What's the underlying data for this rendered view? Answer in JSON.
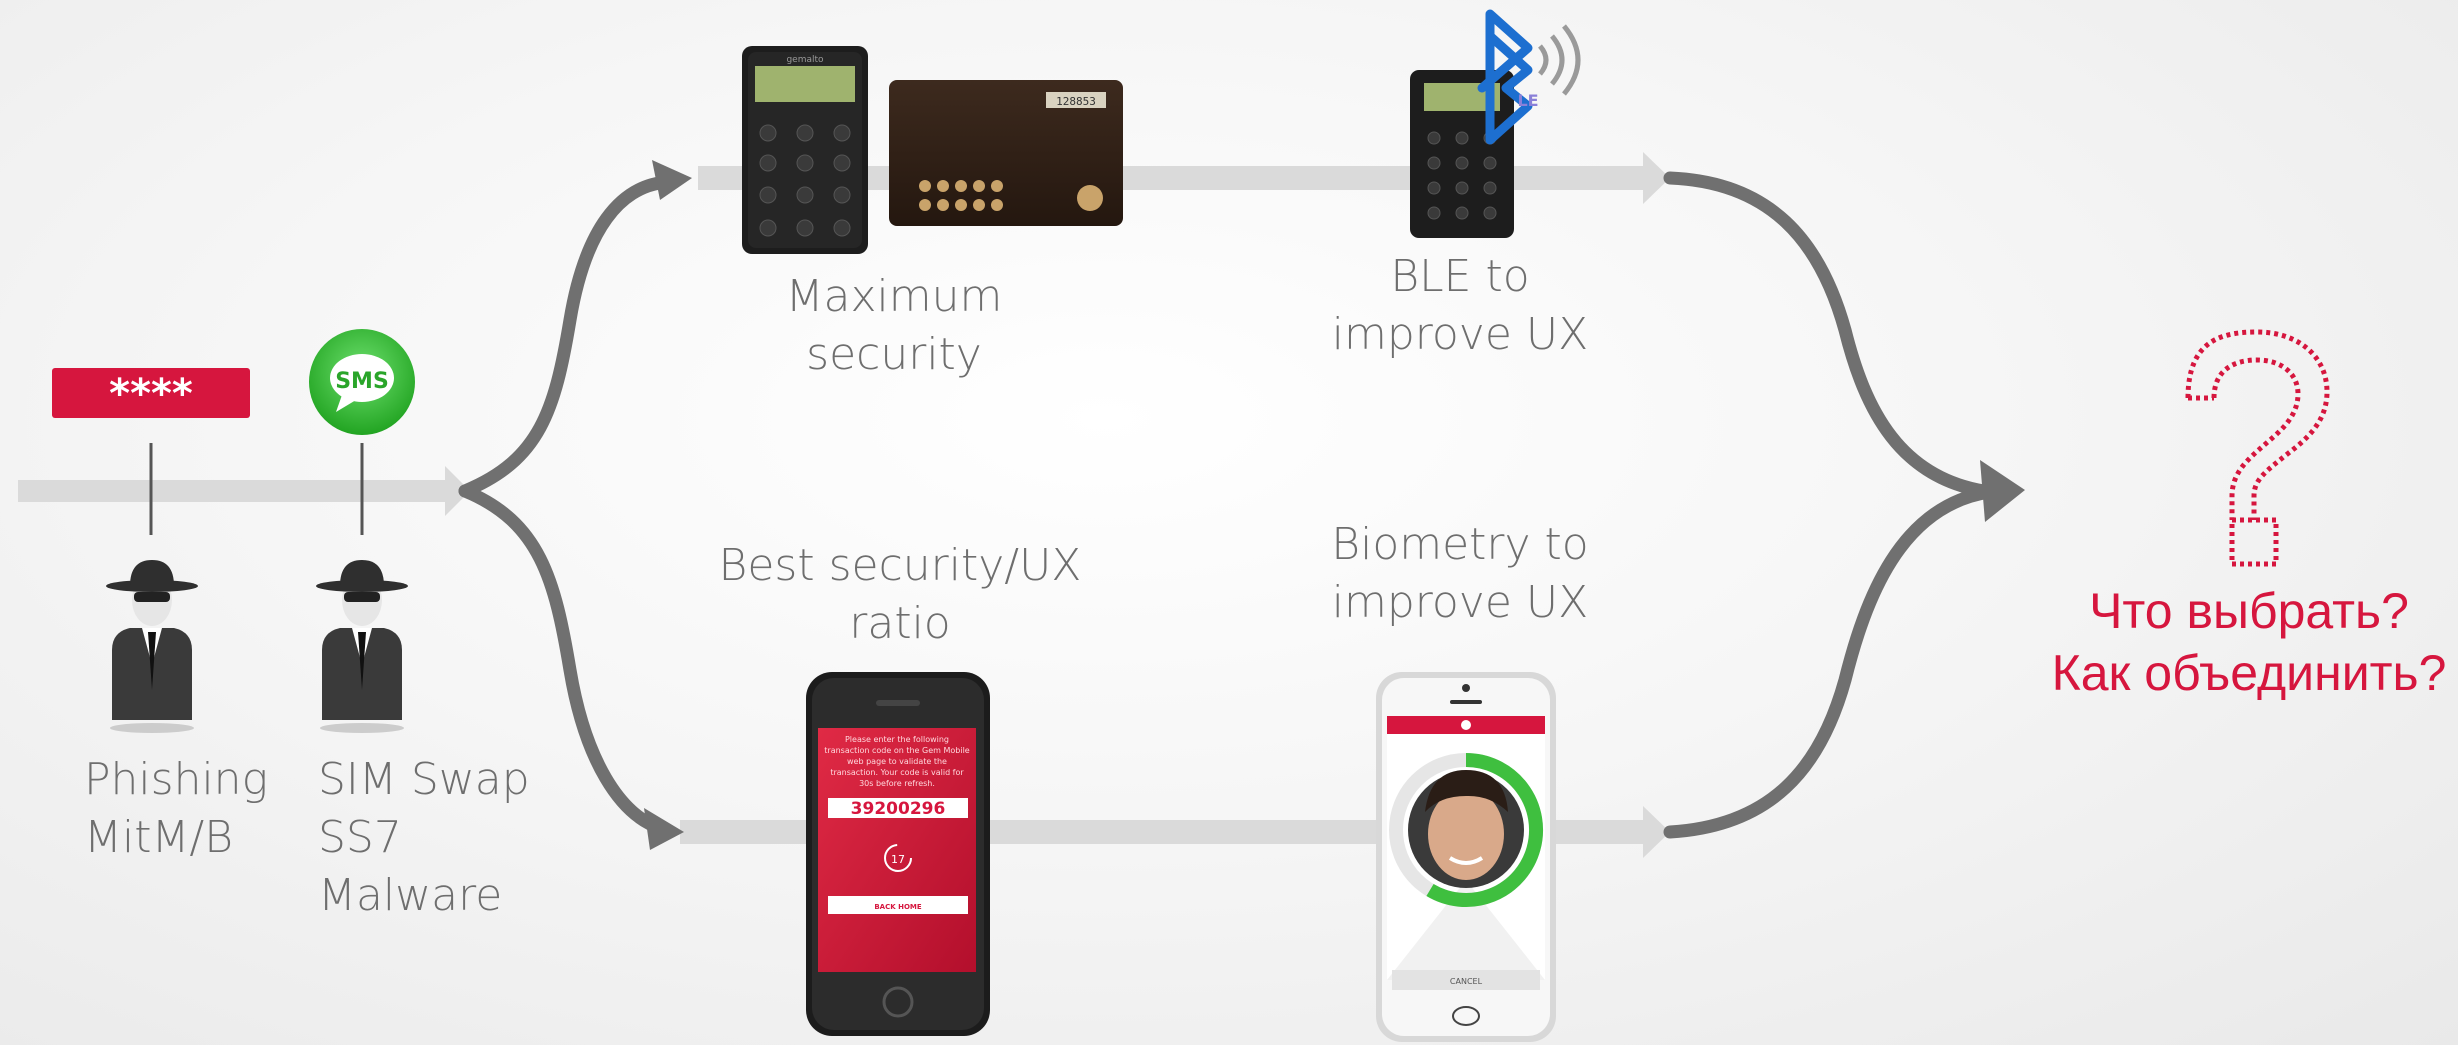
{
  "threats": {
    "password_badge": "****",
    "sms_icon_text": "SMS",
    "left_threats": [
      "Phishing",
      "MitM/B"
    ],
    "right_threats": [
      "SIM Swap",
      "SS7",
      "Malware"
    ]
  },
  "top_path": {
    "max_security": [
      "Maximum",
      "security"
    ],
    "ble_label": [
      "BLE to",
      "improve UX"
    ],
    "ble_icon_text": "LE",
    "token_brand": "gemalto",
    "card_display": "128853"
  },
  "bottom_path": {
    "best_ratio": [
      "Best security/UX",
      "ratio"
    ],
    "biometry": [
      "Biometry to",
      "improve UX"
    ],
    "phone_code": "39200296",
    "phone_timer": "17",
    "phone_instructions": "Please enter the following transaction code on the Gem Mobile web page to validate the transaction. Your code is valid for 30s before refresh.",
    "phone_button": "BACK HOME",
    "bio_cancel": "CANCEL"
  },
  "result": {
    "lines": [
      "Что выбрать?",
      "Как объединить?"
    ]
  },
  "colors": {
    "red": "#d6163e",
    "arrow_dark": "#707070",
    "arrow_light": "#dadada",
    "text": "#6e6e6e",
    "green": "#3fbf3f"
  }
}
